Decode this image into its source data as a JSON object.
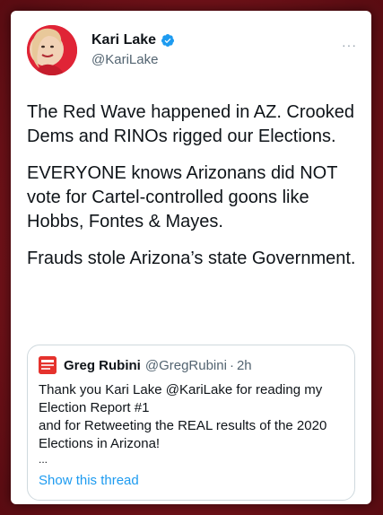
{
  "tweet": {
    "author_name": "Kari Lake",
    "author_handle": "@KariLake",
    "more_icon": "more-horizontal-icon",
    "verified_icon": "verified-badge-icon",
    "paragraphs": [
      "The Red Wave happened in AZ. Crooked Dems and RINOs rigged our Elections.",
      "EVERYONE knows Arizonans  did NOT vote for Cartel-controlled goons like Hobbs, Fontes & Mayes.",
      "Frauds stole Arizona’s state Government."
    ]
  },
  "quote": {
    "author_name": "Greg Rubini",
    "author_handle": "@GregRubini",
    "separator": "·",
    "time": "2h",
    "lines": [
      "Thank you Kari Lake @KariLake for reading my",
      "Election Report #1",
      "and for Retweeting the REAL results of the 2020",
      "Elections in Arizona!"
    ],
    "ellipsis": "...",
    "show_thread": "Show this thread"
  },
  "colors": {
    "background": "#7d1a22",
    "link": "#1d9bf0",
    "verified": "#1d9bf0",
    "secondary_text": "#536471",
    "quote_avatar": "#e5322d"
  }
}
